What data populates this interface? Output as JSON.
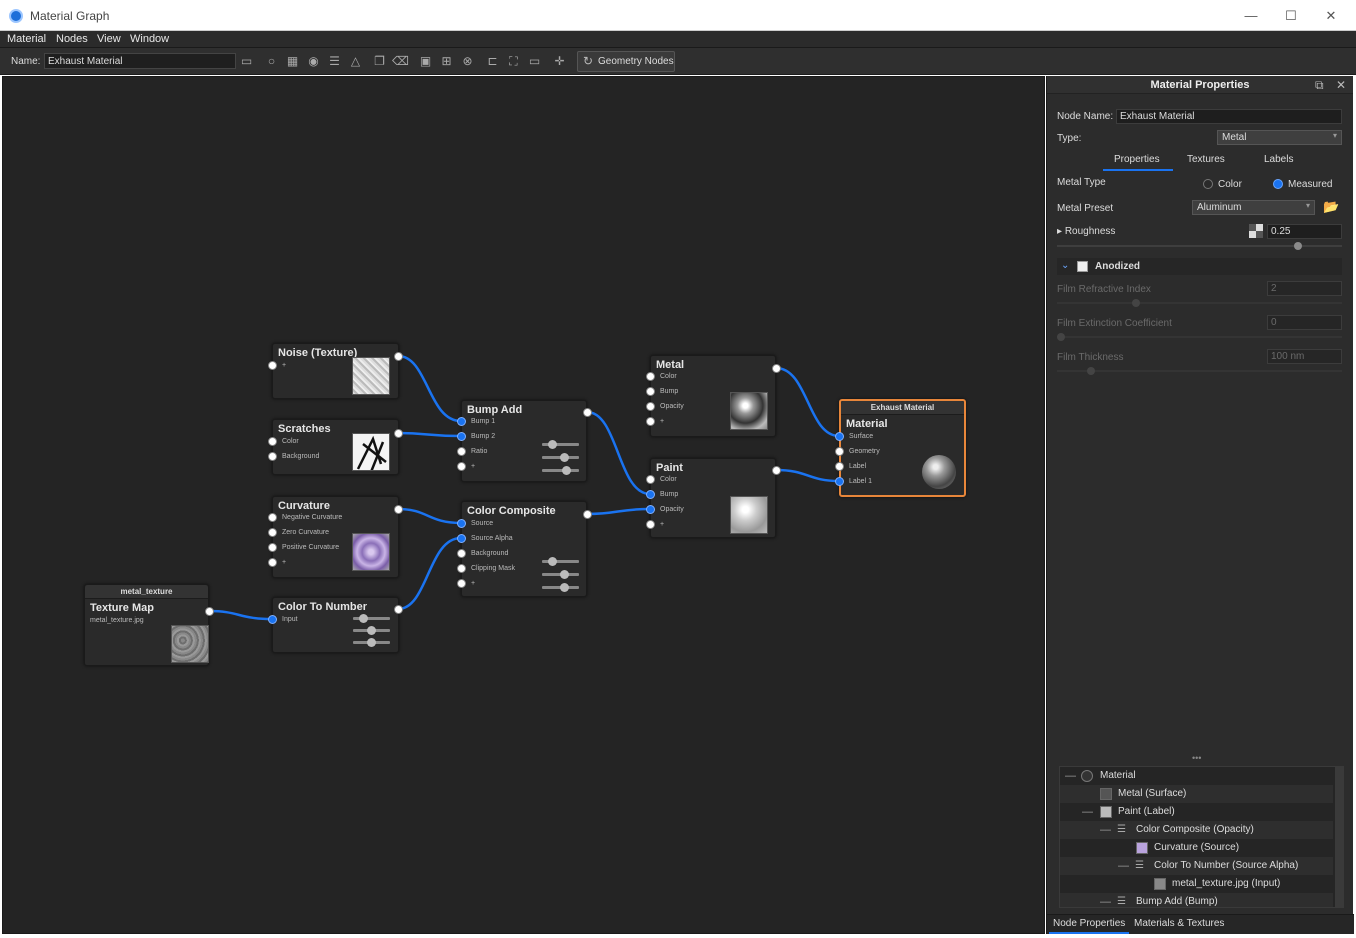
{
  "window": {
    "title": "Material Graph",
    "controls": [
      "—",
      "☐",
      "✕"
    ]
  },
  "menu": [
    "Material",
    "Nodes",
    "View",
    "Window"
  ],
  "toolbar": {
    "name_label": "Name:",
    "name_value": "Exhaust Material",
    "geometry_button": "Geometry Nodes"
  },
  "nodes": {
    "noise": {
      "title": "Noise (Texture)",
      "ports": [
        "+"
      ]
    },
    "scratches": {
      "title": "Scratches",
      "ports": [
        "Color",
        "Background"
      ]
    },
    "curvature": {
      "title": "Curvature",
      "ports": [
        "Negative Curvature",
        "Zero Curvature",
        "Positive Curvature",
        "+"
      ]
    },
    "texture_map": {
      "header": "metal_texture",
      "title": "Texture Map",
      "file": "metal_texture.jpg"
    },
    "color_to_number": {
      "title": "Color To Number",
      "ports": [
        "Input"
      ]
    },
    "bump_add": {
      "title": "Bump Add",
      "ports": [
        "Bump 1",
        "Bump 2",
        "Ratio",
        "+"
      ]
    },
    "color_composite": {
      "title": "Color Composite",
      "ports": [
        "Source",
        "Source Alpha",
        "Background",
        "Clipping Mask",
        "+"
      ]
    },
    "metal": {
      "title": "Metal",
      "ports": [
        "Color",
        "Bump",
        "Opacity",
        "+"
      ]
    },
    "paint": {
      "title": "Paint",
      "ports": [
        "Color",
        "Bump",
        "Opacity",
        "+"
      ]
    },
    "material": {
      "header": "Exhaust Material",
      "title": "Material",
      "ports": [
        "Surface",
        "Geometry",
        "Label",
        "Label 1"
      ]
    }
  },
  "panel": {
    "title": "Material Properties",
    "node_name_label": "Node Name:",
    "node_name_value": "Exhaust Material",
    "type_label": "Type:",
    "type_value": "Metal",
    "tabs": [
      "Properties",
      "Textures",
      "Labels"
    ],
    "active_tab": "Properties",
    "metal_type_label": "Metal Type",
    "metal_type_options": [
      "Color",
      "Measured"
    ],
    "metal_type_selected": "Measured",
    "metal_preset_label": "Metal Preset",
    "metal_preset_value": "Aluminum",
    "roughness_label": "Roughness",
    "roughness_value": "0.25",
    "anodized_label": "Anodized",
    "film_refractive_label": "Film Refractive Index",
    "film_refractive_value": "2",
    "film_extinction_label": "Film Extinction Coefficient",
    "film_extinction_value": "0",
    "film_thickness_label": "Film Thickness",
    "film_thickness_value": "100 nm",
    "more": "•••",
    "tree": [
      {
        "toggle": "—",
        "label": "Material"
      },
      {
        "toggle": "",
        "label": "Metal (Surface)"
      },
      {
        "toggle": "—",
        "label": "Paint (Label)"
      },
      {
        "toggle": "—",
        "label": "Color Composite (Opacity)"
      },
      {
        "toggle": "",
        "label": "Curvature (Source)"
      },
      {
        "toggle": "—",
        "label": "Color To Number (Source Alpha)"
      },
      {
        "toggle": "",
        "label": "metal_texture.jpg (Input)"
      },
      {
        "toggle": "—",
        "label": "Bump Add (Bump)"
      }
    ],
    "bottom_tabs": [
      "Node Properties",
      "Materials & Textures"
    ]
  },
  "colors": {
    "accent": "#1a73f0",
    "selected_node": "#e8863a",
    "canvas": "#242424"
  }
}
